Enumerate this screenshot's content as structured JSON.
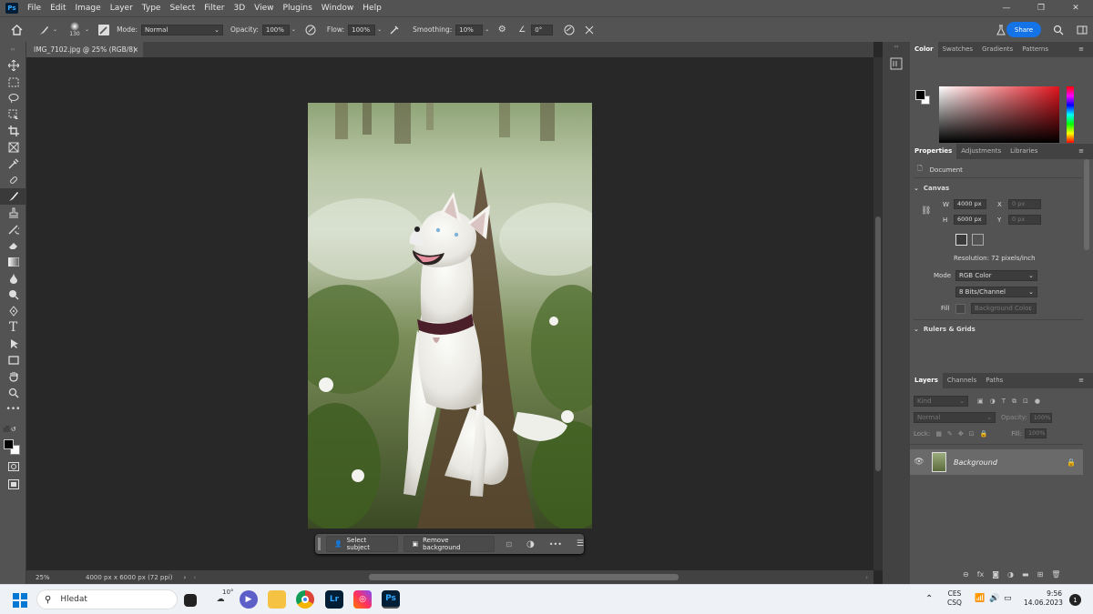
{
  "app": {
    "logo": "Ps"
  },
  "menu": [
    "File",
    "Edit",
    "Image",
    "Layer",
    "Type",
    "Select",
    "Filter",
    "3D",
    "View",
    "Plugins",
    "Window",
    "Help"
  ],
  "window_controls": [
    "—",
    "❐",
    "✕"
  ],
  "options": {
    "brush_size": "130",
    "mode_label": "Mode:",
    "mode_value": "Normal",
    "opacity_label": "Opacity:",
    "opacity_value": "100%",
    "flow_label": "Flow:",
    "flow_value": "100%",
    "smoothing_label": "Smoothing:",
    "smoothing_value": "10%",
    "angle_value": "0°",
    "share_label": "Share"
  },
  "document": {
    "tab_title": "IMG_7102.jpg @ 25% (RGB/8)",
    "zoom": "25%",
    "dimensions": "4000 px x 6000 px (72 ppi)"
  },
  "context_bar": {
    "select_subject": "Select subject",
    "remove_background": "Remove background",
    "more": "•••"
  },
  "color_panel": {
    "tabs": [
      "Color",
      "Swatches",
      "Gradients",
      "Patterns"
    ]
  },
  "properties_panel": {
    "tabs": [
      "Properties",
      "Adjustments",
      "Libraries"
    ],
    "doc_label": "Document",
    "canvas_label": "Canvas",
    "w_label": "W",
    "w_value": "4000 px",
    "x_label": "X",
    "x_value": "0 px",
    "h_label": "H",
    "h_value": "6000 px",
    "y_label": "Y",
    "y_value": "0 px",
    "resolution": "Resolution: 72 pixels/inch",
    "mode_label": "Mode",
    "mode_value": "RGB Color",
    "bits_value": "8 Bits/Channel",
    "fill_label": "Fill",
    "fill_value": "Background Color",
    "rulers_label": "Rulers & Grids"
  },
  "layers_panel": {
    "tabs": [
      "Layers",
      "Channels",
      "Paths"
    ],
    "kind_placeholder": "Kind",
    "blend": "Normal",
    "opacity_label": "Opacity:",
    "opacity_value": "100%",
    "lock_label": "Lock:",
    "fill_label": "Fill:",
    "fill_value": "100%",
    "layer_name": "Background"
  },
  "taskbar": {
    "search": "Hledat",
    "weather": "10°",
    "lang1": "CES",
    "lang2": "CSQ",
    "time": "9:56",
    "date": "14.06.2023",
    "notif": "1"
  }
}
